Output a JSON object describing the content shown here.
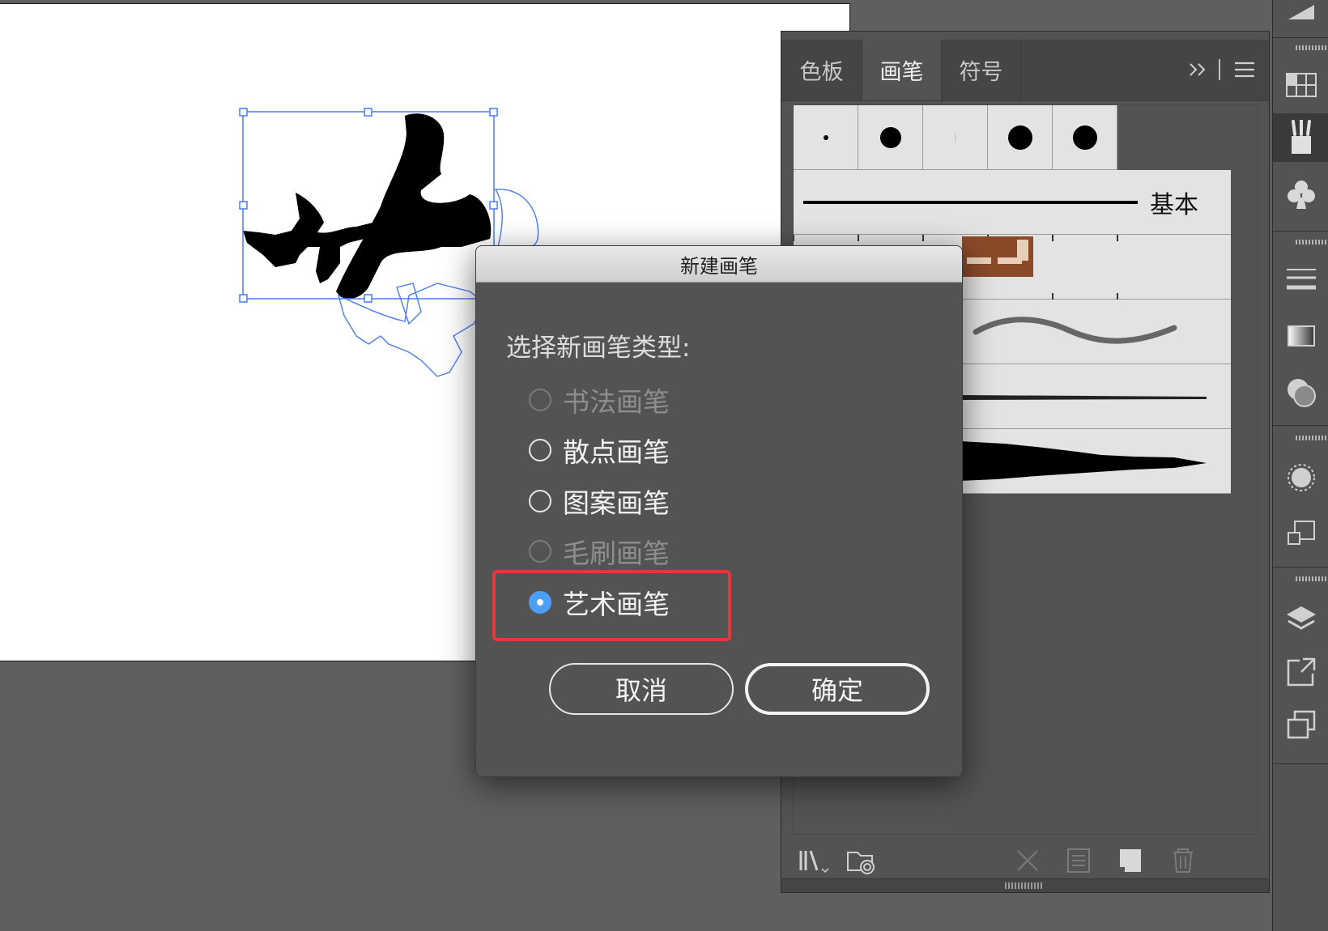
{
  "panel": {
    "tabs": [
      {
        "label": "色板",
        "active": false
      },
      {
        "label": "画笔",
        "active": true
      },
      {
        "label": "符号",
        "active": false
      }
    ],
    "collapse_icon": "double-chevron-right-icon",
    "menu_icon": "hamburger-menu-icon",
    "basic_brush_label": "基本"
  },
  "dialog": {
    "title": "新建画笔",
    "prompt": "选择新画笔类型:",
    "options": [
      {
        "label": "书法画笔",
        "enabled": false,
        "selected": false
      },
      {
        "label": "散点画笔",
        "enabled": true,
        "selected": false
      },
      {
        "label": "图案画笔",
        "enabled": true,
        "selected": false
      },
      {
        "label": "毛刷画笔",
        "enabled": false,
        "selected": false
      },
      {
        "label": "艺术画笔",
        "enabled": true,
        "selected": true
      }
    ],
    "cancel_label": "取消",
    "ok_label": "确定"
  },
  "colors": {
    "selection": "#4a7cf0",
    "highlight": "#e4393c",
    "radio_selected": "#4b9ff5"
  }
}
